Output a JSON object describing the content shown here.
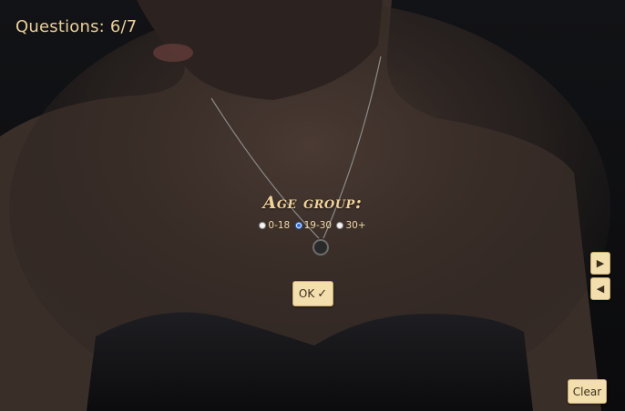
{
  "header": {
    "progress_text": "Questions: 6/7"
  },
  "question": {
    "title": "Age group:",
    "options": [
      {
        "label": "0-18",
        "selected": false
      },
      {
        "label": "19-30",
        "selected": true
      },
      {
        "label": "30+",
        "selected": false
      }
    ]
  },
  "buttons": {
    "ok_label": "OK",
    "ok_icon": "check-icon",
    "next_icon": "play-right-icon",
    "prev_icon": "play-left-icon",
    "clear_label": "Clear"
  },
  "colors": {
    "text_accent": "#e9cf9a",
    "button_bg": "#f3dfae",
    "radio_selected": "#2f6fd6"
  }
}
